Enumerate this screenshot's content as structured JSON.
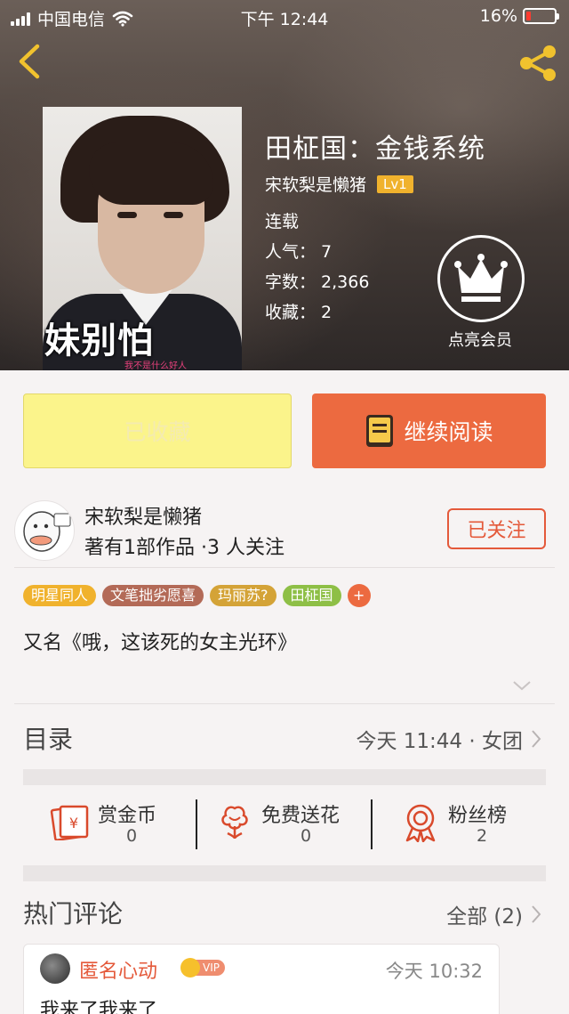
{
  "status_bar": {
    "carrier": "中国电信",
    "time": "下午 12:44",
    "battery": "16%",
    "battery_level": 0.16
  },
  "book": {
    "cover_text": "妹别怕",
    "cover_caption": "我不是什么好人",
    "title": "田柾国：金钱系统",
    "author": "宋软梨是懒猪",
    "author_level": "Lv1",
    "status": "连载",
    "popularity_label": "人气：",
    "popularity": "7",
    "words_label": "字数：",
    "words": "2,366",
    "favorites_label": "收藏：",
    "favorites": "2",
    "vip_label": "点亮会员"
  },
  "actions": {
    "collected_label": "已收藏",
    "continue_label": "继续阅读"
  },
  "author_card": {
    "name": "宋软梨是懒猪",
    "stats": "著有1部作品 ·3 人关注",
    "follow_label": "已关注"
  },
  "tags": [
    {
      "label": "明星同人",
      "color": "#f0b22d"
    },
    {
      "label": "文笔拙劣愿喜",
      "color": "#b36a57"
    },
    {
      "label": "玛丽苏?",
      "color": "#d4a337"
    },
    {
      "label": "田柾国",
      "color": "#8ebf46"
    }
  ],
  "tag_add": "+",
  "alias": "又名《哦，这该死的女主光环》",
  "toc": {
    "title": "目录",
    "info": "今天 11:44 · 女团"
  },
  "stats": {
    "gold": {
      "label": "赏金币",
      "value": "0"
    },
    "flowers": {
      "label": "免费送花",
      "value": "0"
    },
    "fans": {
      "label": "粉丝榜",
      "value": "2"
    }
  },
  "comments": {
    "title": "热门评论",
    "all_label": "全部 (2)",
    "items": [
      {
        "user": "匿名心动",
        "badge": "VIP",
        "time": "今天 10:32",
        "text": "我来了我来了"
      }
    ]
  },
  "colors": {
    "accent": "#ec6a40",
    "follow": "#e4593a",
    "collected_bg": "#fbf48b",
    "level_badge": "#f0b22d"
  }
}
